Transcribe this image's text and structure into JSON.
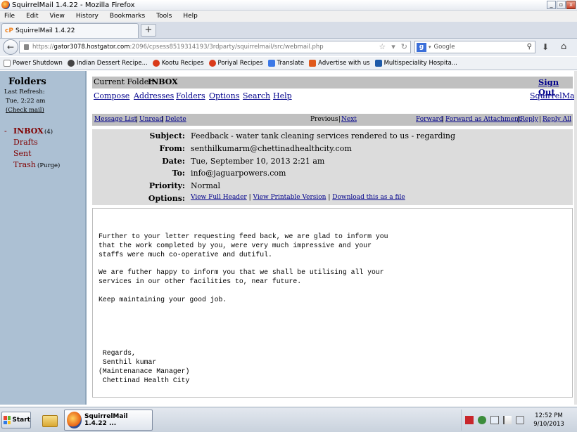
{
  "window": {
    "title": "SquirrelMail 1.4.22 - Mozilla Firefox",
    "min": "_",
    "max": "▫",
    "close": "x"
  },
  "menu": [
    "File",
    "Edit",
    "View",
    "History",
    "Bookmarks",
    "Tools",
    "Help"
  ],
  "tab": {
    "icon": "cP",
    "label": "SquirrelMail 1.4.22",
    "new_tab": "+"
  },
  "nav": {
    "url_prefix": "https://",
    "url_host": "gator3078.hostgator.com",
    "url_rest": ":2096/cpsess8519314193/3rdparty/squirrelmail/src/webmail.php",
    "search_engine": "g",
    "search_placeholder": "Google"
  },
  "bookmarks": [
    {
      "label": "Power Shutdown",
      "color": "#ffffff"
    },
    {
      "label": "Indian Dessert Recipe...",
      "color": "#444444"
    },
    {
      "label": "Kootu Recipes",
      "color": "#d93a1a"
    },
    {
      "label": "Poriyal Recipes",
      "color": "#d93a1a"
    },
    {
      "label": "Translate",
      "color": "#3b78e7"
    },
    {
      "label": "Advertise with us",
      "color": "#e05a1c"
    },
    {
      "label": "Multispeciality Hospita...",
      "color": "#1e5aa8"
    }
  ],
  "left": {
    "title": "Folders",
    "last_refresh_label": "Last Refresh:",
    "last_refresh_value": "Tue, 2:22 am",
    "check_mail": "(Check mail)",
    "folders": {
      "inbox": "INBOX",
      "inbox_count": "(4)",
      "drafts": "Drafts",
      "sent": "Sent",
      "trash": "Trash",
      "purge": "(Purge)"
    }
  },
  "main": {
    "current_folder_label": "Current Folder:",
    "current_folder": "INBOX",
    "sign_out": "Sign Out",
    "nav_links": [
      "Compose",
      "Addresses",
      "Folders",
      "Options",
      "Search",
      "Help"
    ],
    "brand_link": "SquirrelMail",
    "msg_bar": {
      "message_list": "Message List",
      "unread": "Unread",
      "delete": "Delete",
      "previous": "Previous",
      "next": "Next",
      "forward": "Forward",
      "forward_attach": "Forward as Attachment",
      "reply": "Reply",
      "reply_all": "Reply All"
    },
    "headers": {
      "subject_label": "Subject:",
      "subject": "Feedback - water tank cleaning services rendered to us - regarding",
      "from_label": "From:",
      "from": "senthilkumarm@chettinadhealthcity.com",
      "date_label": "Date:",
      "date": "Tue, September 10, 2013 2:21 am",
      "to_label": "To:",
      "to": "info@jaguarpowers.com",
      "priority_label": "Priority:",
      "priority": "Normal",
      "options_label": "Options:",
      "opt_full_header": "View Full Header",
      "opt_printable": "View Printable Version",
      "opt_download": "Download this as a file"
    },
    "body": "Further to your letter requesting feed back, we are glad to inform you\nthat the work completed by you, were very much impressive and your\nstaffs were much co-operative and dutiful.\n\nWe are futher happy to inform you that we shall be utilising all your\nservices in our other facilities to, near future.\n\nKeep maintaining your good job.\n\n\n\n\n\n Regards,\n Senthil kumar\n(Maintenanace Manager)\n Chettinad Health City"
  },
  "taskbar": {
    "start": "Start",
    "firefox_button": "SquirrelMail 1.4.22 ...",
    "clock_time": "12:52 PM",
    "clock_date": "9/10/2013"
  }
}
